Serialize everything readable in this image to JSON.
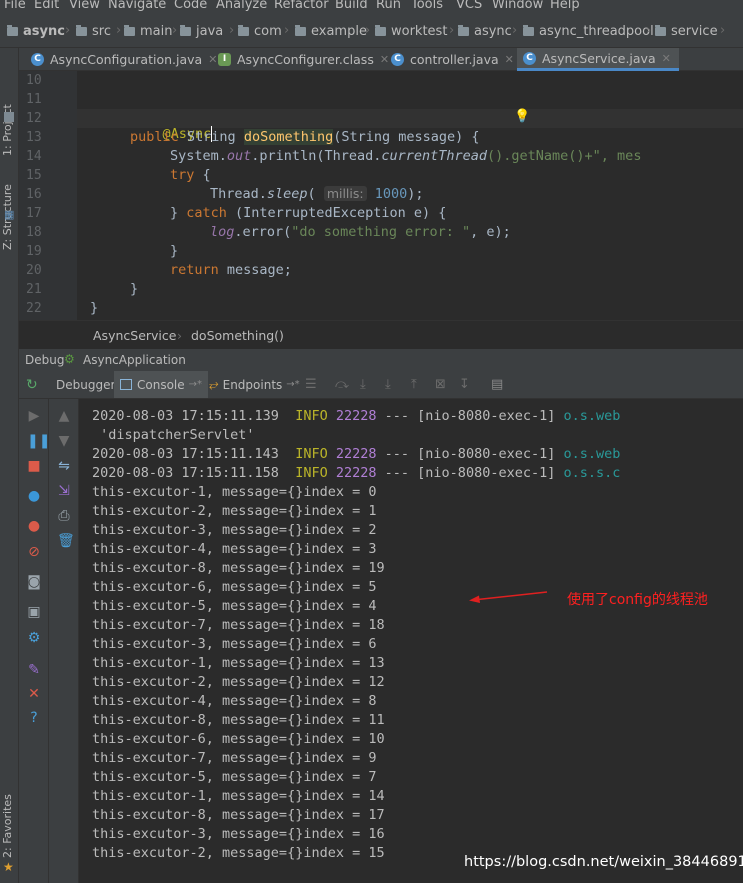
{
  "menu": [
    "File",
    "Edit",
    "View",
    "Navigate",
    "Code",
    "Analyze",
    "Refactor",
    "Build",
    "Run",
    "Tools",
    "VCS",
    "Window",
    "Help"
  ],
  "nav": {
    "project": "async",
    "crumbs": [
      "src",
      "main",
      "java",
      "com",
      "example",
      "worktest",
      "async",
      "async_threadpool",
      "service"
    ]
  },
  "left_stripe": {
    "project": "1: Project",
    "structure": "Z: Structure",
    "favorites": "2: Favorites"
  },
  "tabs": [
    {
      "label": "AsyncConfiguration.java",
      "icon": "java-class-icon",
      "active": false
    },
    {
      "label": "AsyncConfigurer.class",
      "icon": "interface-class-icon",
      "active": false
    },
    {
      "label": "controller.java",
      "icon": "java-class-icon",
      "active": false
    },
    {
      "label": "AsyncService.java",
      "icon": "java-class-icon",
      "active": true
    }
  ],
  "editor": {
    "line_numbers": [
      "10",
      "11",
      "12",
      "13",
      "14",
      "15",
      "16",
      "17",
      "18",
      "19",
      "20",
      "21",
      "22"
    ],
    "code": {
      "l12_ann": "@Async",
      "l13_kw": "public",
      "l13_type": " String ",
      "l13_method": "doSomething",
      "l13_params": "(String message) {",
      "l14_a": "System.",
      "l14_out": "out",
      "l14_b": ".println(Thread.",
      "l14_ct": "currentThread",
      "l14_c": "().getName()+\", mes",
      "l15_kw": "try",
      "l15_rest": " {",
      "l16_a": "Thread.",
      "l16_sleep": "sleep",
      "l16_b": "( ",
      "l16_hint": "millis:",
      "l16_num": " 1000",
      "l16_c": ");",
      "l17_a": "} ",
      "l17_kw": "catch",
      "l17_b": " (InterruptedException e) {",
      "l18_log": "log",
      "l18_a": ".error(",
      "l18_str": "\"do something error: \"",
      "l18_b": ", e);",
      "l19": "}",
      "l20_kw": "return",
      "l20_rest": " message;",
      "l21": "}",
      "l22": "}"
    }
  },
  "editor_crumb": {
    "class": "AsyncService",
    "method": "doSomething()"
  },
  "debug": {
    "label": "Debug",
    "app": "AsyncApplication",
    "tabs": {
      "debugger": "Debugger",
      "console": "Console",
      "endpoints": "Endpoints"
    }
  },
  "console": {
    "log_lines": [
      {
        "ts": "2020-08-03 17:15:11.139",
        "level": "INFO",
        "pid": "22228",
        "sep": "---",
        "thread": "[nio-8080-exec-1]",
        "logger": "o.s.web"
      },
      {
        "ts": "2020-08-03 17:15:11.143",
        "level": "INFO",
        "pid": "22228",
        "sep": "---",
        "thread": "[nio-8080-exec-1]",
        "logger": "o.s.web"
      },
      {
        "ts": "2020-08-03 17:15:11.158",
        "level": "INFO",
        "pid": "22228",
        "sep": "---",
        "thread": "[nio-8080-exec-1]",
        "logger": "o.s.s.c"
      }
    ],
    "servlet_line": " 'dispatcherServlet'",
    "output": [
      "this-excutor-1, message={}index = 0",
      "this-excutor-2, message={}index = 1",
      "this-excutor-3, message={}index = 2",
      "this-excutor-4, message={}index = 3",
      "this-excutor-8, message={}index = 19",
      "this-excutor-6, message={}index = 5",
      "this-excutor-5, message={}index = 4",
      "this-excutor-7, message={}index = 18",
      "this-excutor-3, message={}index = 6",
      "this-excutor-1, message={}index = 13",
      "this-excutor-2, message={}index = 12",
      "this-excutor-4, message={}index = 8",
      "this-excutor-8, message={}index = 11",
      "this-excutor-6, message={}index = 10",
      "this-excutor-7, message={}index = 9",
      "this-excutor-5, message={}index = 7",
      "this-excutor-1, message={}index = 14",
      "this-excutor-8, message={}index = 17",
      "this-excutor-3, message={}index = 16",
      "this-excutor-2, message={}index = 15"
    ]
  },
  "annotation": {
    "note": "使用了config的线程池",
    "color": "#e02020"
  },
  "watermark": "https://blog.csdn.net/weixin_38446891",
  "colors": {
    "accent": "#4a88c7",
    "keyword": "#cc7832",
    "string": "#6a8759",
    "annotation": "#bbb529",
    "logger": "#299999"
  }
}
